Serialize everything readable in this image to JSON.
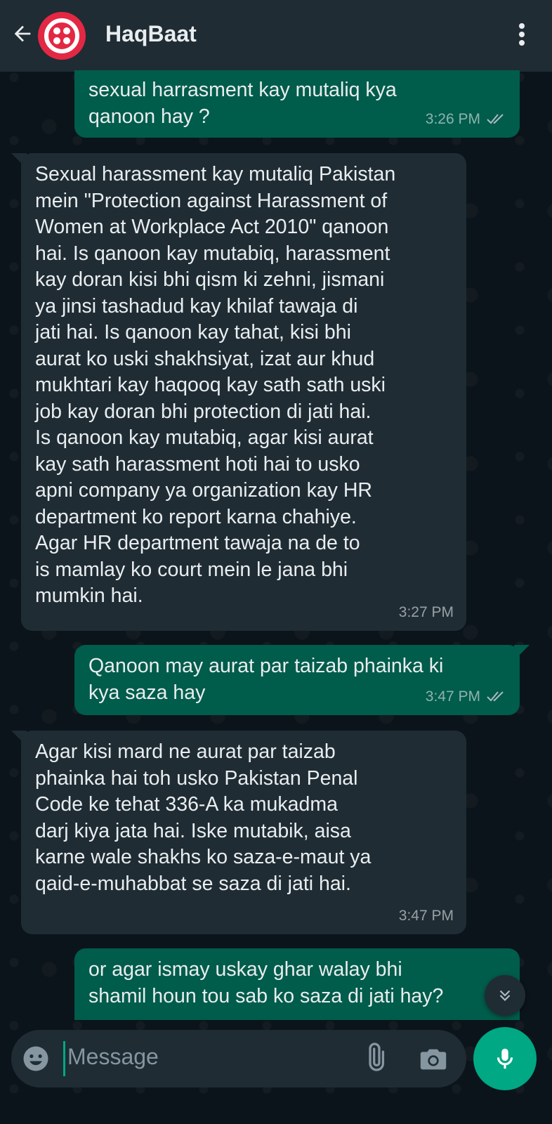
{
  "header": {
    "title": "HaqBaat",
    "back_icon": "arrow-left-icon",
    "avatar_icon": "twilio-logo-icon",
    "menu_icon": "more-vertical-icon"
  },
  "messages": [
    {
      "direction": "out",
      "text": "sexual harrasment kay mutaliq kya\nqanoon hay ?",
      "time": "3:26 PM",
      "status": "read"
    },
    {
      "direction": "in",
      "text": "Sexual harassment kay mutaliq Pakistan\nmein \"Protection against Harassment of\nWomen at Workplace Act 2010\" qanoon\nhai. Is qanoon kay mutabiq, harassment\nkay doran kisi bhi qism ki zehni, jismani\nya jinsi tashadud kay khilaf tawaja di\njati hai. Is qanoon kay tahat, kisi bhi\naurat ko uski shakhsiyat, izat aur khud\nmukhtari kay haqooq kay sath sath uski\njob kay doran bhi protection di jati hai.\nIs qanoon kay mutabiq, agar kisi aurat\nkay sath harassment hoti hai to usko\napni company ya organization kay HR\ndepartment ko report karna chahiye.\nAgar HR department tawaja na de to\nis mamlay ko court mein le jana bhi\nmumkin hai.",
      "time": "3:27 PM"
    },
    {
      "direction": "out",
      "text": "Qanoon may aurat par taizab phainka ki\nkya saza hay",
      "time": "3:47 PM",
      "status": "read"
    },
    {
      "direction": "in",
      "text": "Agar kisi mard ne aurat par taizab\nphainka hai toh usko Pakistan Penal\nCode ke tehat 336-A ka mukadma\ndarj kiya jata hai. Iske mutabik, aisa\nkarne wale shakhs ko saza-e-maut ya\nqaid-e-muhabbat se saza di jati hai.",
      "time": "3:47 PM"
    },
    {
      "direction": "out",
      "text": "or agar ismay uskay ghar walay bhi\nshamil houn tou sab ko saza di jati hay?",
      "time": "",
      "status": ""
    }
  ],
  "composer": {
    "placeholder": "Message",
    "emoji_icon": "emoji-icon",
    "attach_icon": "paperclip-icon",
    "camera_icon": "camera-icon",
    "mic_icon": "microphone-icon"
  },
  "scroll_icon": "chevrons-down-icon",
  "colors": {
    "background": "#0b141a",
    "header": "#1f2c34",
    "outgoing_bubble": "#005c4b",
    "incoming_bubble": "#1f2c34",
    "accent": "#00a884",
    "avatar": "#e32844"
  }
}
